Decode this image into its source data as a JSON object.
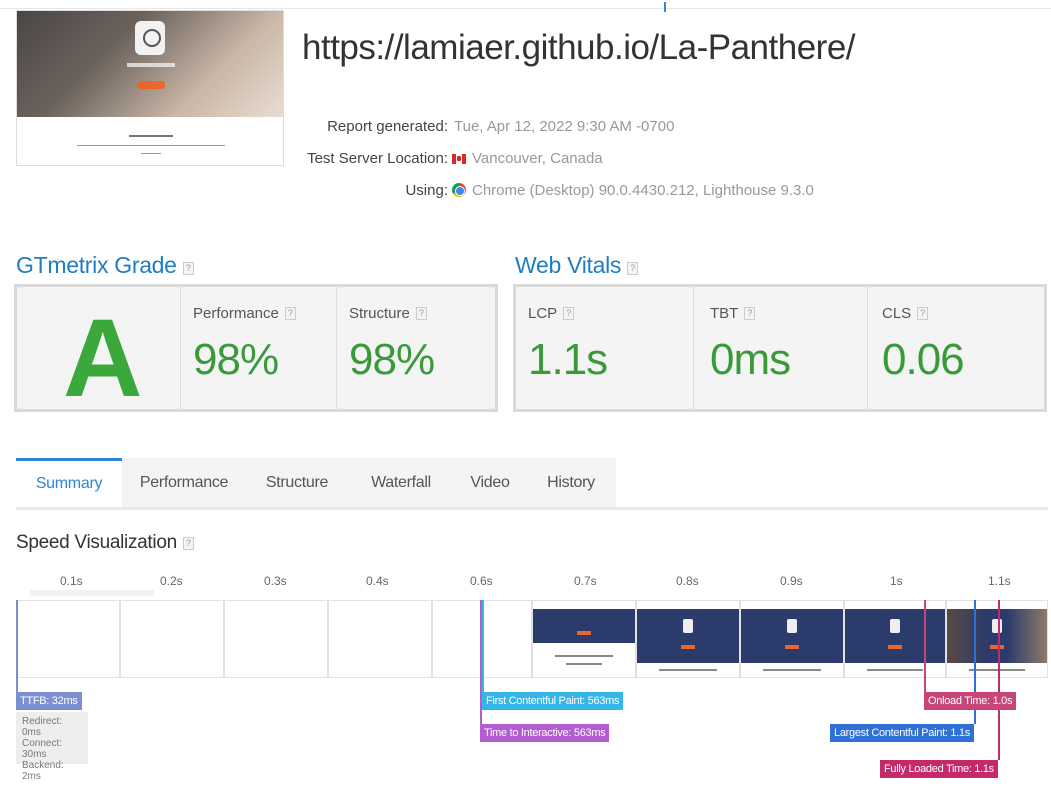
{
  "report": {
    "url": "https://lamiaer.github.io/La-Panthere/",
    "meta": [
      {
        "label": "Report generated:",
        "value": "Tue, Apr 12, 2022 9:30 AM -0700",
        "icon": null
      },
      {
        "label": "Test Server Location:",
        "value": "Vancouver, Canada",
        "icon": "canada-flag-icon"
      },
      {
        "label": "Using:",
        "value": "Chrome (Desktop) 90.0.4430.212, Lighthouse 9.3.0",
        "icon": "chrome-icon"
      }
    ]
  },
  "grade": {
    "title": "GTmetrix Grade",
    "letter": "A",
    "performance_label": "Performance",
    "performance_value": "98%",
    "structure_label": "Structure",
    "structure_value": "98%",
    "color": "#3aa83a"
  },
  "vitals": {
    "title": "Web Vitals",
    "lcp_label": "LCP",
    "lcp_value": "1.1s",
    "tbt_label": "TBT",
    "tbt_value": "0ms",
    "cls_label": "CLS",
    "cls_value": "0.06"
  },
  "tabs": [
    "Summary",
    "Performance",
    "Structure",
    "Waterfall",
    "Video",
    "History"
  ],
  "active_tab": "Summary",
  "speed": {
    "title": "Speed Visualization",
    "ticks": [
      "0.1s",
      "0.2s",
      "0.3s",
      "0.4s",
      "0.6s",
      "0.7s",
      "0.8s",
      "0.9s",
      "1s",
      "1.1s"
    ],
    "ttfb": "TTFB: 32ms",
    "ttfb_details": [
      "Redirect: 0ms",
      "Connect: 30ms",
      "Backend: 2ms"
    ],
    "fcp": "First Contentful Paint: 563ms",
    "tti": "Time to Interactive: 563ms",
    "onload": "Onload Time: 1.0s",
    "lcp": "Largest Contentful Paint: 1.1s",
    "fully_loaded": "Fully Loaded Time: 1.1s",
    "colors": {
      "ttfb": "#7b8fd1",
      "fcp": "#35b6e8",
      "tti": "#b35bd0",
      "onload": "#c8457a",
      "lcp": "#2f6fd8",
      "fully_loaded": "#c42a6a"
    }
  }
}
